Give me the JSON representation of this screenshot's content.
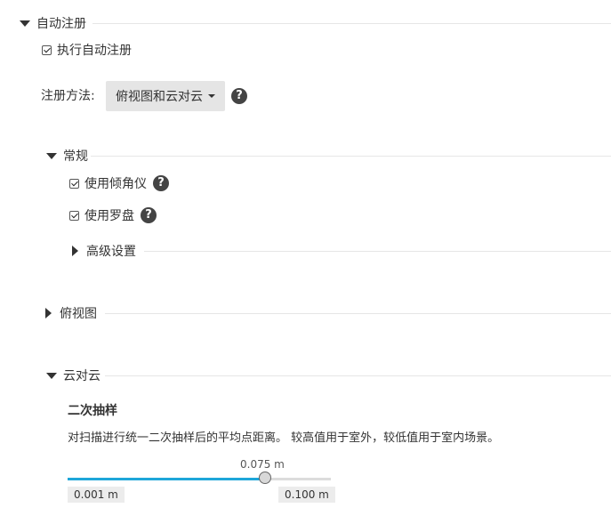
{
  "auto_register": {
    "title": "自动注册",
    "execute_label": "执行自动注册",
    "execute_checked": true,
    "method_label": "注册方法:",
    "method_value": "俯视图和云对云"
  },
  "general": {
    "title": "常规",
    "use_inclinometer": "使用倾角仪",
    "use_compass": "使用罗盘",
    "advanced": "高级设置"
  },
  "top_view": {
    "title": "俯视图"
  },
  "cloud_to_cloud": {
    "title": "云对云",
    "subsample_title": "二次抽样",
    "subsample_desc": "对扫描进行统一二次抽样后的平均点距离。 较高值用于室外，较低值用于室内场景。",
    "slider": {
      "value_label": "0.075 m",
      "min_label": "0.001 m",
      "max_label": "0.100 m",
      "fraction": 0.75
    }
  },
  "colors": {
    "accent": "#1ea6d9"
  },
  "icons": {
    "help": "?"
  }
}
